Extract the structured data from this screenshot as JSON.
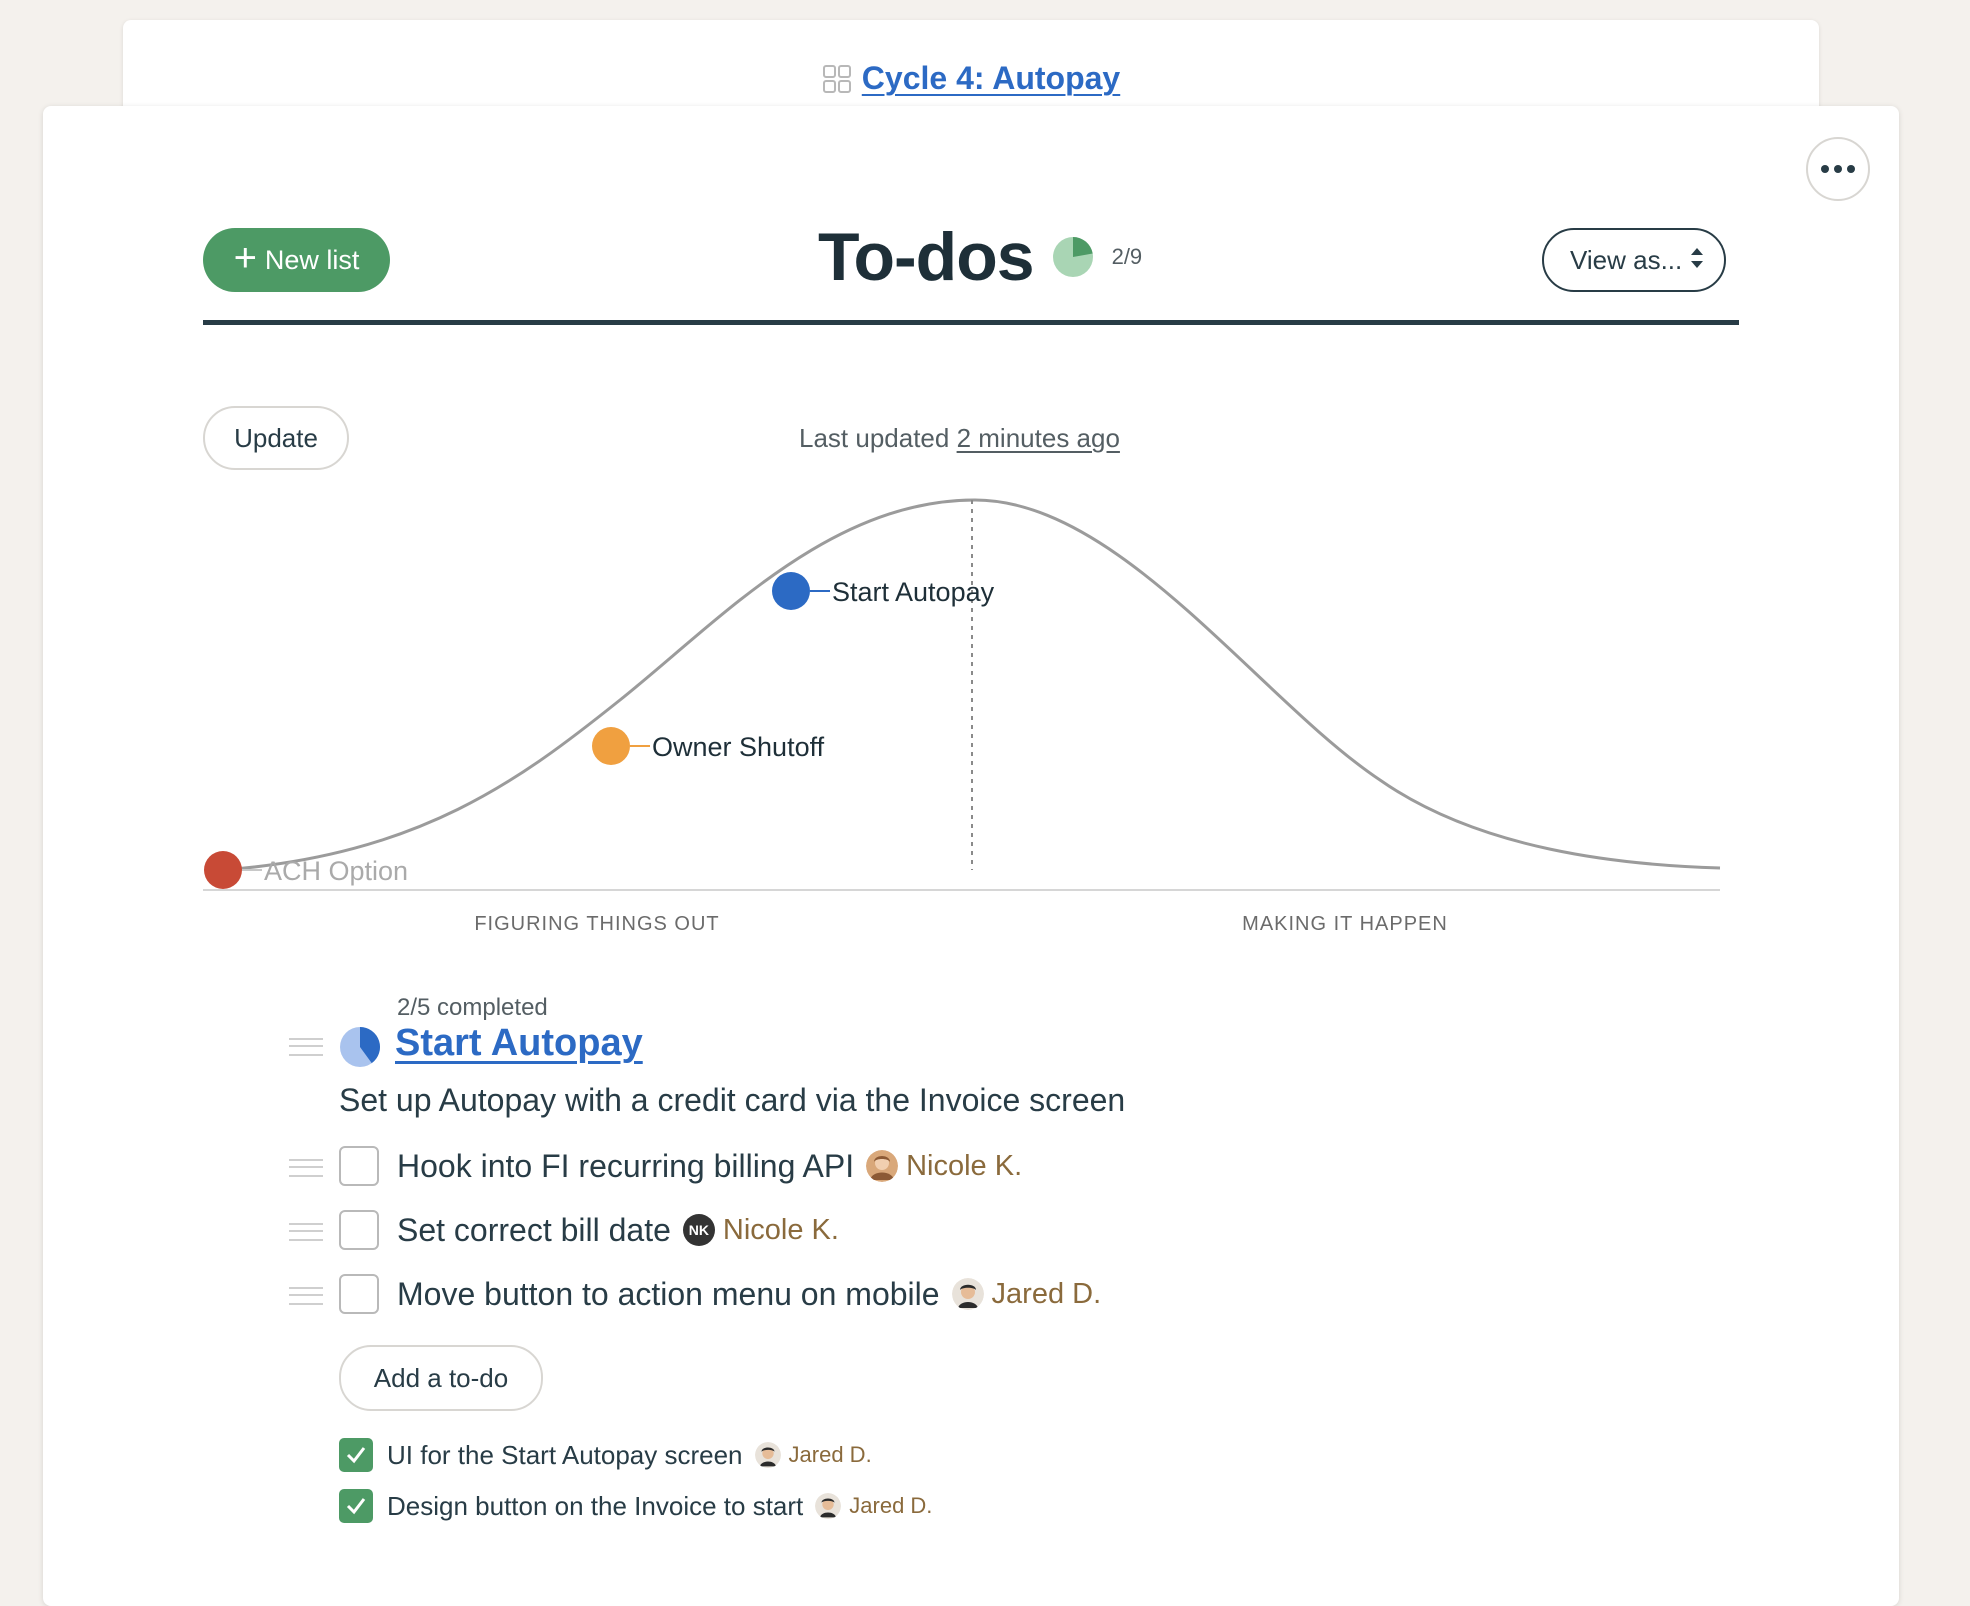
{
  "breadcrumb": {
    "label": "Cycle 4: Autopay"
  },
  "header": {
    "new_list_label": "New list",
    "title": "To-dos",
    "progress_text": "2/9",
    "progress_fraction": 0.2222,
    "view_as_label": "View as..."
  },
  "hill": {
    "update_label": "Update",
    "last_updated_prefix": "Last updated",
    "last_updated_link": "2 minutes ago",
    "left_section": "FIGURING THINGS OUT",
    "right_section": "MAKING IT HAPPEN",
    "points": [
      {
        "label": "ACH Option",
        "color": "#c84a36",
        "faded": true
      },
      {
        "label": "Owner Shutoff",
        "color": "#f0a040",
        "faded": false
      },
      {
        "label": "Start Autopay",
        "color": "#2c6ac4",
        "faded": false
      }
    ]
  },
  "list": {
    "completed_note": "2/5 completed",
    "progress_fraction": 0.4,
    "title": "Start Autopay",
    "description": "Set up Autopay with a credit card via the Invoice screen",
    "todos": [
      {
        "text": "Hook into FI recurring billing API",
        "assignee": "Nicole K.",
        "avatar": "photo-f"
      },
      {
        "text": "Set correct bill date",
        "assignee": "Nicole K.",
        "avatar_initials": "NK"
      },
      {
        "text": "Move button to action menu on mobile",
        "assignee": "Jared D.",
        "avatar": "photo-m"
      }
    ],
    "add_todo_label": "Add a to-do",
    "completed": [
      {
        "text": "UI for the Start Autopay screen",
        "assignee": "Jared D."
      },
      {
        "text": "Design button on the Invoice to start",
        "assignee": "Jared D."
      }
    ]
  },
  "colors": {
    "accent_green": "#4d9a65",
    "link_blue": "#2c6ac4",
    "ink": "#283c46",
    "assignee": "#8a6a3c"
  }
}
